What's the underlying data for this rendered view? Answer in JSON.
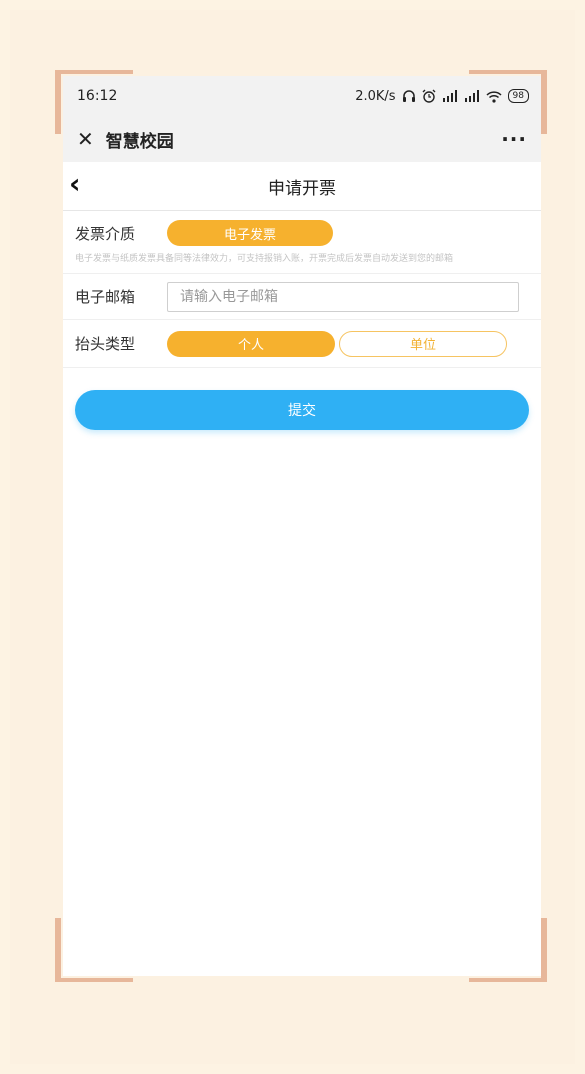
{
  "status_bar": {
    "time": "16:12",
    "network_speed": "2.0K/s",
    "headset_icon": "headset-icon",
    "alarm_icon": "alarm-icon",
    "signal_icons": "signal-icon",
    "wifi_icon": "wifi-icon",
    "battery": "98"
  },
  "wechat_bar": {
    "close_icon": "close-icon",
    "app_title": "智慧校园",
    "more_icon": "more-icon"
  },
  "nav": {
    "back_icon": "chevron-left-icon",
    "title": "申请开票"
  },
  "form": {
    "medium_label": "发票介质",
    "medium_option": "电子发票",
    "hint": "电子发票与纸质发票具备同等法律效力，可支持报销入账，开票完成后发票自动发送到您的邮箱",
    "email_label": "电子邮箱",
    "email_placeholder": "请输入电子邮箱",
    "email_value": "",
    "header_label": "抬头类型",
    "header_options": [
      {
        "label": "个人",
        "selected": true
      },
      {
        "label": "单位",
        "selected": false
      }
    ]
  },
  "submit_label": "提交",
  "colors": {
    "accent_orange": "#f6b12e",
    "submit_blue": "#2fb0f4",
    "frame_corner": "#e7b79a",
    "page_bg": "#fdf3e3"
  }
}
